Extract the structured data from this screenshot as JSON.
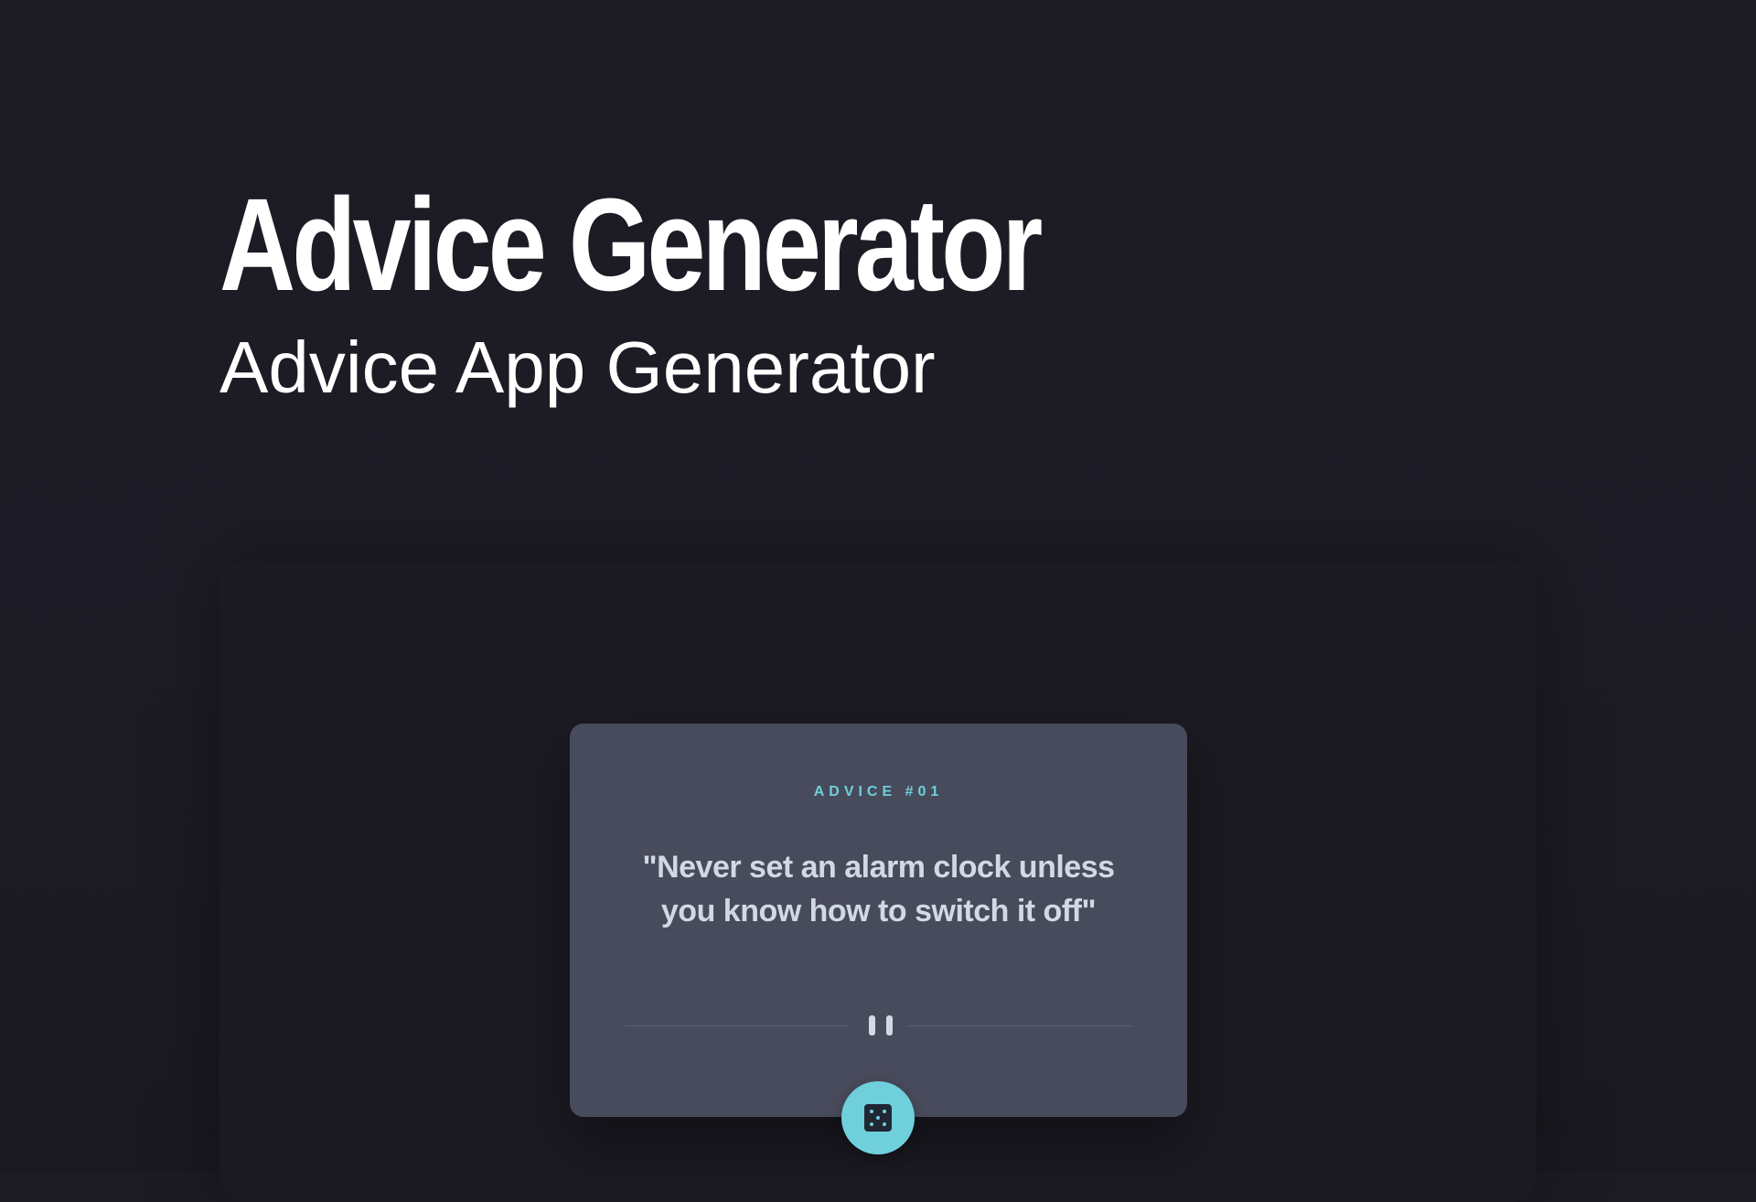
{
  "header": {
    "title": "Advice Generator",
    "subtitle": "Advice App Generator"
  },
  "card": {
    "advice_label": "ADVICE #01",
    "quote": "\"Never set an alarm clock unless you know how to switch it off\"",
    "divider_icon": "pause-icon",
    "button_icon": "dice-icon"
  },
  "colors": {
    "background": "#1c1b24",
    "panel": "#1b1a22",
    "card": "#484b5c",
    "accent": "#6fd0dc",
    "quote_text": "#d2d9e6"
  }
}
